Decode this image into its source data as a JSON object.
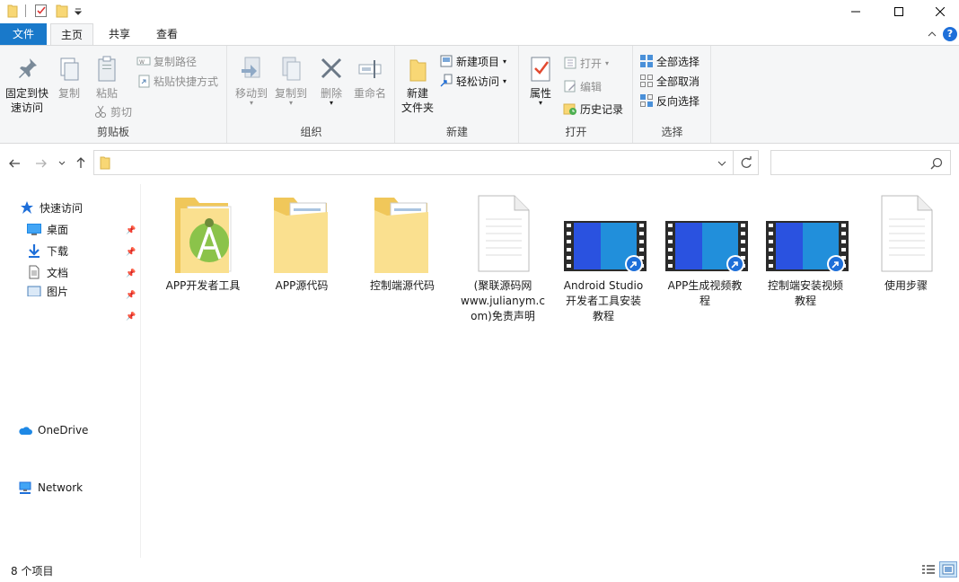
{
  "window": {
    "title": "",
    "minimize_label": "—",
    "maximize_label": "☐",
    "close_label": "✕"
  },
  "tabs": {
    "file": "文件",
    "home": "主页",
    "share": "共享",
    "view": "查看"
  },
  "ribbon": {
    "clipboard": {
      "label": "剪贴板",
      "pin": "固定到快速访问",
      "pin_line1": "固定到快",
      "pin_line2": "速访问",
      "copy": "复制",
      "paste": "粘贴",
      "copy_path": "复制路径",
      "paste_shortcut": "粘贴快捷方式",
      "cut": "剪切"
    },
    "organize": {
      "label": "组织",
      "move_to": "移动到",
      "copy_to": "复制到",
      "delete": "删除",
      "rename": "重命名"
    },
    "new": {
      "label": "新建",
      "new_folder_line1": "新建",
      "new_folder_line2": "文件夹",
      "new_item": "新建项目",
      "easy_access": "轻松访问"
    },
    "open": {
      "label": "打开",
      "properties": "属性",
      "open": "打开",
      "edit": "编辑",
      "history": "历史记录"
    },
    "select": {
      "label": "选择",
      "select_all": "全部选择",
      "select_none": "全部取消",
      "invert": "反向选择"
    }
  },
  "address": {
    "path": "",
    "search_placeholder": ""
  },
  "sidebar": {
    "quick_access": "快速访问",
    "items": [
      {
        "label": "桌面"
      },
      {
        "label": "下载"
      },
      {
        "label": "文档"
      },
      {
        "label": "图片"
      }
    ],
    "onedrive": "OneDrive",
    "network": "Network"
  },
  "files": [
    {
      "name": "APP开发者工具",
      "type": "android-studio-folder"
    },
    {
      "name": "APP源代码",
      "type": "folder"
    },
    {
      "name": "控制端源代码",
      "type": "folder"
    },
    {
      "name": "(聚联源码网www.julianym.com)免责声明",
      "type": "text-file",
      "line1": "(聚联源码网",
      "line2": "www.julianym.c",
      "line3": "om)免责声明"
    },
    {
      "name": "Android Studio开发者工具安装教程",
      "type": "video-shortcut",
      "line1": "Android Studio",
      "line2": "开发者工具安装",
      "line3": "教程"
    },
    {
      "name": "APP生成视频教程",
      "type": "video-shortcut",
      "line1": "APP生成视频教",
      "line2": "程"
    },
    {
      "name": "控制端安装视频教程",
      "type": "video-shortcut",
      "line1": "控制端安装视频",
      "line2": "教程"
    },
    {
      "name": "使用步骤",
      "type": "text-file"
    }
  ],
  "status": {
    "item_count": "8 个项目"
  },
  "colors": {
    "file_tab": "#1979ca",
    "folder": "#f8d775",
    "accent_blue": "#1e6fd9"
  }
}
